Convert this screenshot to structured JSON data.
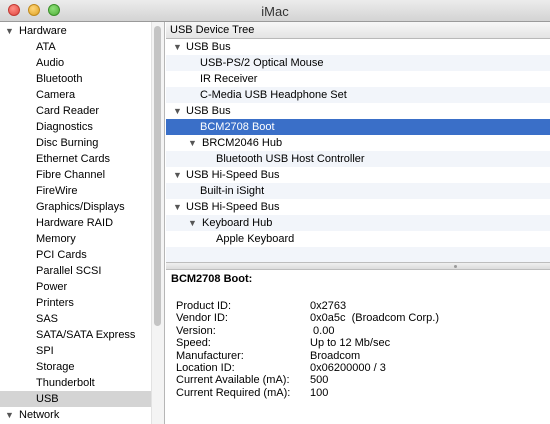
{
  "window": {
    "title": "iMac"
  },
  "sidebar": {
    "group_hardware": "Hardware",
    "items": [
      "ATA",
      "Audio",
      "Bluetooth",
      "Camera",
      "Card Reader",
      "Diagnostics",
      "Disc Burning",
      "Ethernet Cards",
      "Fibre Channel",
      "FireWire",
      "Graphics/Displays",
      "Hardware RAID",
      "Memory",
      "PCI Cards",
      "Parallel SCSI",
      "Power",
      "Printers",
      "SAS",
      "SATA/SATA Express",
      "SPI",
      "Storage",
      "Thunderbolt",
      "USB"
    ],
    "selected": "USB",
    "group_network": "Network"
  },
  "tree": {
    "header": "USB Device Tree",
    "rows": [
      {
        "label": "USB Bus",
        "level": 0,
        "expanded": true
      },
      {
        "label": "USB-PS/2 Optical Mouse",
        "level": 2
      },
      {
        "label": "IR Receiver",
        "level": 2
      },
      {
        "label": "C-Media USB Headphone Set",
        "level": 2
      },
      {
        "label": "USB Bus",
        "level": 0,
        "expanded": true
      },
      {
        "label": "BCM2708 Boot",
        "level": 2,
        "selected": true
      },
      {
        "label": "BRCM2046 Hub",
        "level": 1,
        "expanded": true
      },
      {
        "label": "Bluetooth USB Host Controller",
        "level": 3
      },
      {
        "label": "USB Hi-Speed Bus",
        "level": 0,
        "expanded": true
      },
      {
        "label": "Built-in iSight",
        "level": 2
      },
      {
        "label": "USB Hi-Speed Bus",
        "level": 0,
        "expanded": true
      },
      {
        "label": "Keyboard Hub",
        "level": 1,
        "expanded": true
      },
      {
        "label": "Apple Keyboard",
        "level": 3
      }
    ]
  },
  "details": {
    "title": "BCM2708 Boot:",
    "properties": [
      {
        "label": "Product ID:",
        "value": "0x2763"
      },
      {
        "label": "Vendor ID:",
        "value": "0x0a5c  (Broadcom Corp.)"
      },
      {
        "label": "Version:",
        "value": " 0.00"
      },
      {
        "label": "Speed:",
        "value": "Up to 12 Mb/sec"
      },
      {
        "label": "Manufacturer:",
        "value": "Broadcom"
      },
      {
        "label": "Location ID:",
        "value": "0x06200000 / 3"
      },
      {
        "label": "Current Available (mA):",
        "value": "500"
      },
      {
        "label": "Current Required (mA):",
        "value": "100"
      }
    ]
  }
}
